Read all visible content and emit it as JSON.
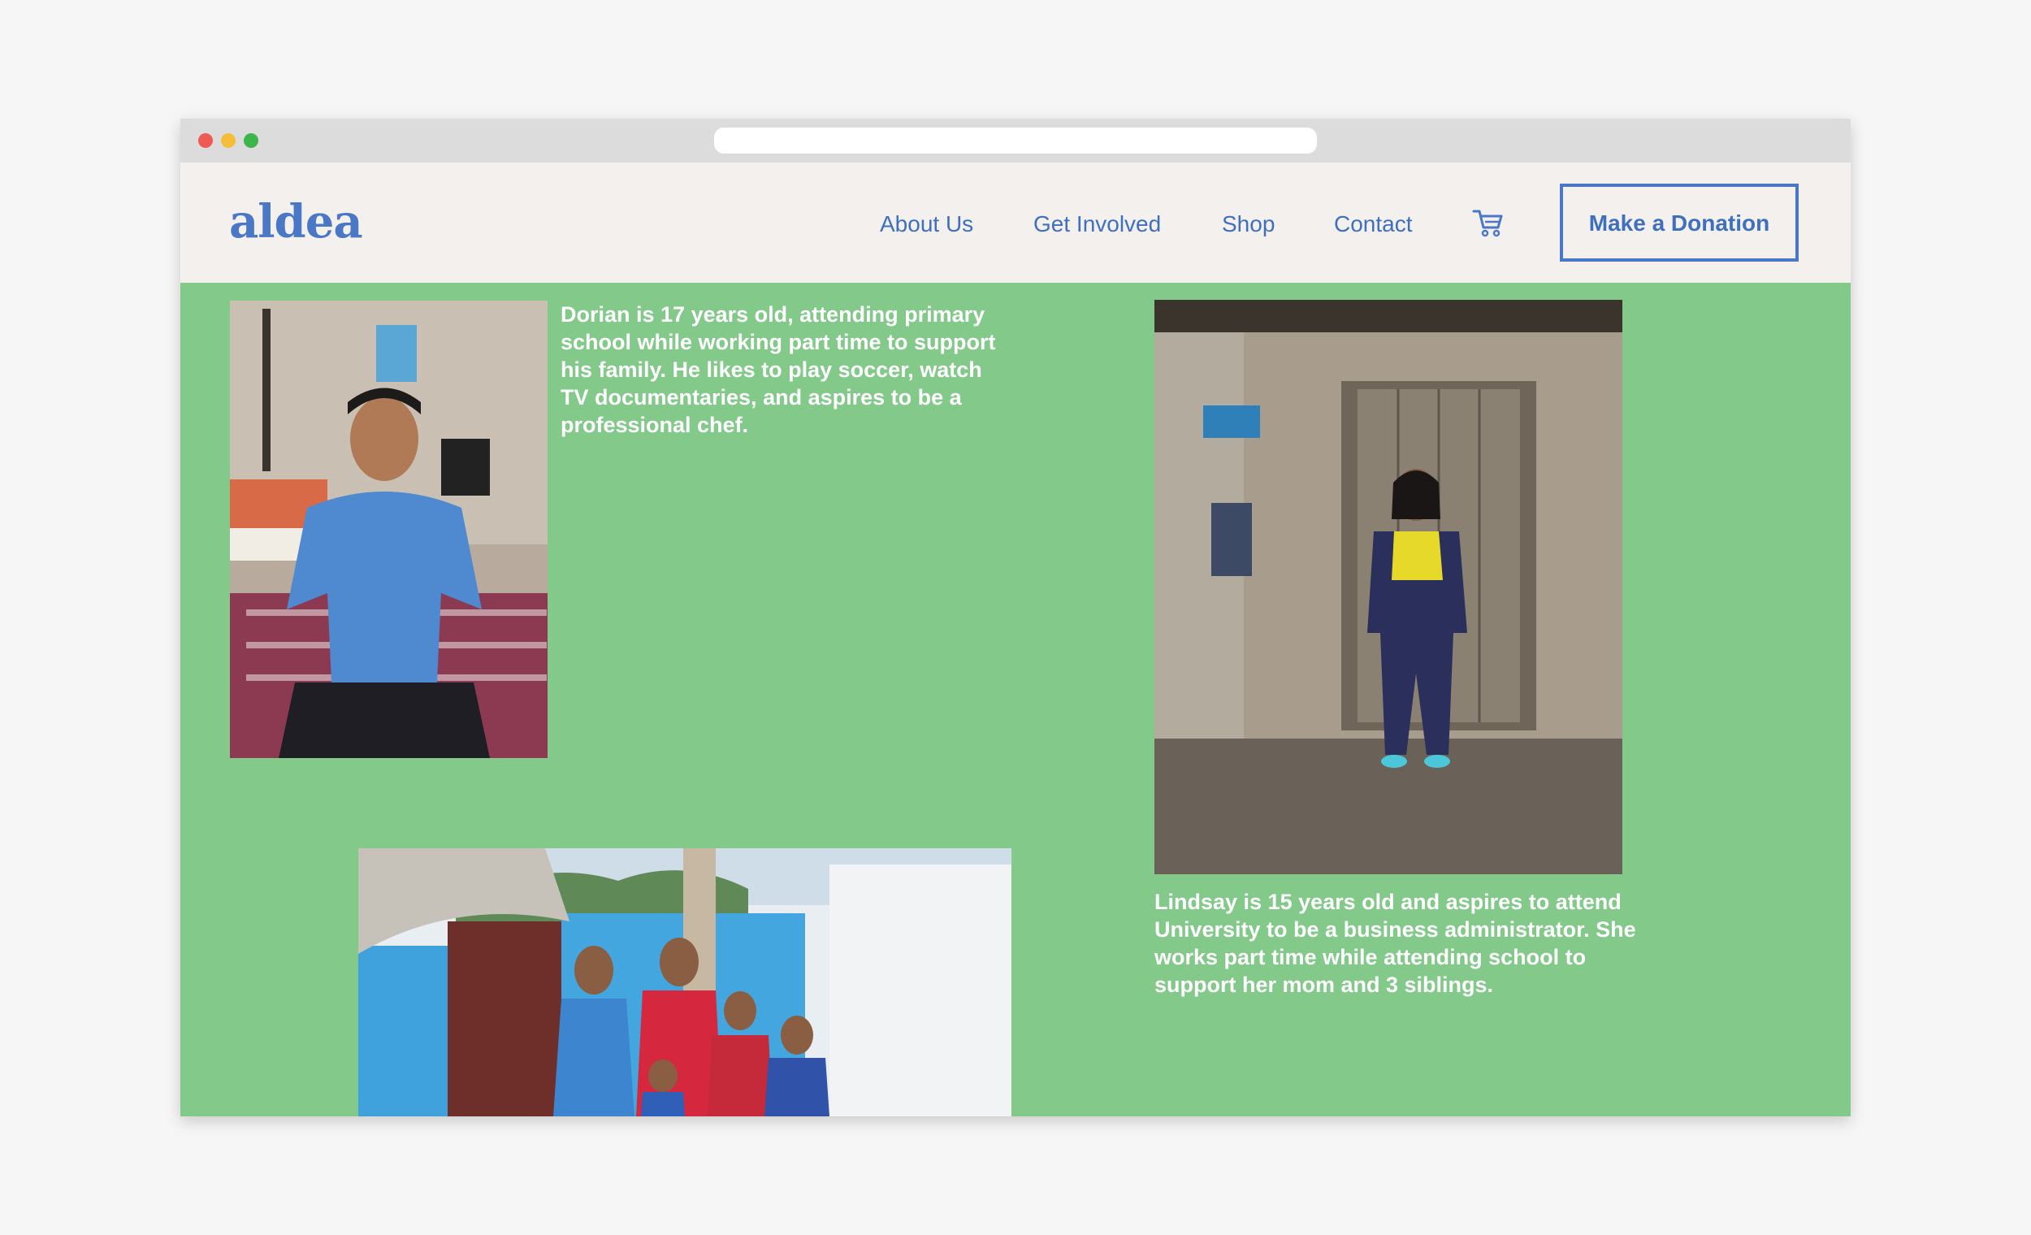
{
  "brand": {
    "logo": "aldea",
    "color": "#4a78c6"
  },
  "nav": {
    "links": [
      "About Us",
      "Get Involved",
      "Shop",
      "Contact"
    ],
    "cart_icon": "cart-icon",
    "donate_label": "Make a Donation"
  },
  "stories": {
    "dorian": "Dorian is 17 years old, attending primary school while working part time to support his family. He likes to play soccer, watch TV documentaries, and aspires to be a professional chef.",
    "lindsay": "Lindsay is 15 years old and aspires to attend University to be a business administrator. She works part time while attending school to support her mom and 3 siblings."
  },
  "colors": {
    "page_bg": "#82c98a",
    "nav_bg": "#f3f0ee",
    "accent": "#4a78c6"
  }
}
